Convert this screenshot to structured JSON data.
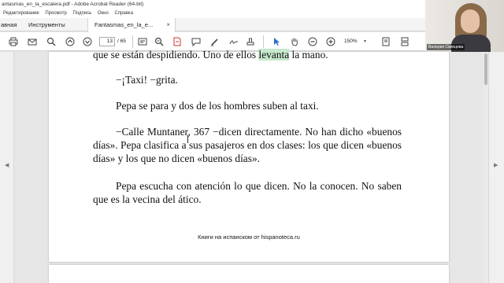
{
  "window": {
    "title": "antasmas_en_la_escalera.pdf - Adobe Acrobat Reader (64-bit)"
  },
  "menu": [
    "Редактирование",
    "Просмотр",
    "Подпись",
    "Окно",
    "Справка"
  ],
  "tabs": {
    "home": "авная",
    "tools": "Инструменты",
    "document": "Fantasmas_en_la_e..."
  },
  "toolbar": {
    "current_page": "13",
    "total_pages": "/ 65",
    "zoom": "150%"
  },
  "webcam": {
    "name": "Валерия Свинцева"
  },
  "document": {
    "line1_a": "que se están despidiendo. Uno de ellos ",
    "line1_hl": "levanta",
    "line1_b": " la mano.",
    "para2": "−¡Taxi! −grita.",
    "para3": "Pepa se para y dos de los hombres suben al taxi.",
    "para4": "−Calle Muntaner, 367 −dicen directamente. No han dicho «buenos días». Pepa clasifica a sus pasajeros en dos clases: los que dicen «buenos días» y los que no dicen «buenos días».",
    "para5": "Pepa escucha con atención lo que dicen. No la conocen. No saben que es la vecina del ático.",
    "footer": "Книги на испанском от hispanoteca.ru"
  }
}
